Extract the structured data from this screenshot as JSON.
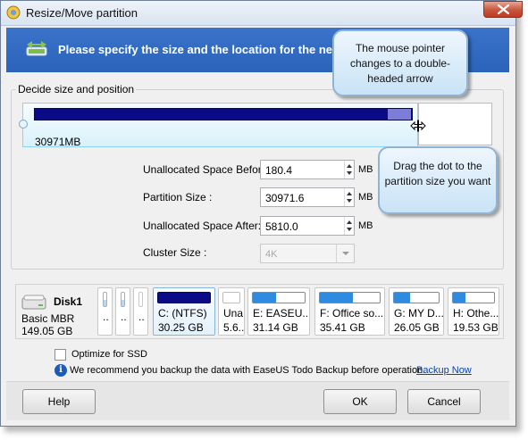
{
  "window": {
    "title": "Resize/Move partition",
    "header_text": "Please specify the size and the location for the ne"
  },
  "group": {
    "label": "Decide size and position",
    "partition_size_text": "30971MB"
  },
  "form": {
    "before_label": "Unallocated Space Before:",
    "before_value": "180.4",
    "size_label": "Partition Size :",
    "size_value": "30971.6",
    "after_label": "Unallocated Space After:",
    "after_value": "5810.0",
    "cluster_label": "Cluster Size :",
    "cluster_value": "4K",
    "unit": "MB"
  },
  "callouts": {
    "pointer": "The mouse pointer changes to a double-headed arrow",
    "drag": "Drag the dot to the partition size you want"
  },
  "disk": {
    "name": "Disk1",
    "type": "Basic MBR",
    "capacity": "149.05 GB",
    "small_dots": "..",
    "partitions": [
      {
        "name": "C: (NTFS)",
        "size": "30.25 GB",
        "used_fraction": 1.0
      },
      {
        "name": "Una...",
        "size": "5.6...",
        "used_fraction": 0.0
      },
      {
        "name": "E: EASEU...",
        "size": "31.14 GB",
        "used_fraction": 0.45
      },
      {
        "name": "F: Office so...",
        "size": "35.41 GB",
        "used_fraction": 0.55
      },
      {
        "name": "G: MY D...",
        "size": "26.05 GB",
        "used_fraction": 0.35
      },
      {
        "name": "H: Othe...",
        "size": "19.53 GB",
        "used_fraction": 0.3
      }
    ]
  },
  "options": {
    "ssd_label": "Optimize for SSD",
    "recommend_text": "We recommend you backup the data with EaseUS Todo Backup before operation.",
    "backup_link": "Backup Now"
  },
  "buttons": {
    "help": "Help",
    "ok": "OK",
    "cancel": "Cancel"
  },
  "colors": {
    "header": "#2b63bb",
    "used_partition": "#0b0a87",
    "used_space": "#2f8be0"
  }
}
